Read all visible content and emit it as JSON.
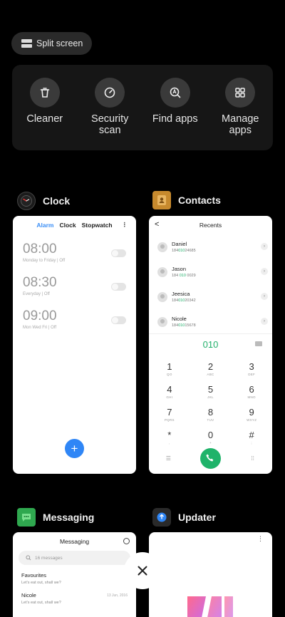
{
  "split_screen": {
    "label": "Split screen"
  },
  "quick_actions": [
    {
      "label": "Cleaner",
      "icon": "trash-icon"
    },
    {
      "label": "Security\nscan",
      "icon": "shield-scan-icon"
    },
    {
      "label": "Find apps",
      "icon": "search-apps-icon"
    },
    {
      "label": "Manage\napps",
      "icon": "grid-icon"
    }
  ],
  "clock": {
    "title": "Clock",
    "tabs": [
      "Alarm",
      "Clock",
      "Stopwatch"
    ],
    "more": "⋮",
    "alarms": [
      {
        "time": "08:00",
        "desc": "Monday to Friday | Off"
      },
      {
        "time": "08:30",
        "desc": "Everyday | Off"
      },
      {
        "time": "09:00",
        "desc": "Mon Wed Fri | Off"
      }
    ],
    "fab": "+"
  },
  "contacts": {
    "title": "Contacts",
    "header": "Recents",
    "back": "<",
    "recents": [
      {
        "name": "Daniel",
        "pre": "184",
        "mid": "010",
        "post": "24685"
      },
      {
        "name": "Jason",
        "pre": "184 ",
        "mid": "010",
        "post": " 0029"
      },
      {
        "name": "Jeesica",
        "pre": "184",
        "mid": "010",
        "post": "20342"
      },
      {
        "name": "Nicole",
        "pre": "184",
        "mid": "010",
        "post": "15678"
      }
    ],
    "input": "010",
    "keys": [
      {
        "n": "1",
        "l": "QO"
      },
      {
        "n": "2",
        "l": "ABC"
      },
      {
        "n": "3",
        "l": "DEF"
      },
      {
        "n": "4",
        "l": "GHI"
      },
      {
        "n": "5",
        "l": "JKL"
      },
      {
        "n": "6",
        "l": "MNO"
      },
      {
        "n": "7",
        "l": "PQRS"
      },
      {
        "n": "8",
        "l": "TUV"
      },
      {
        "n": "9",
        "l": "WXYZ"
      },
      {
        "n": "*",
        "l": ","
      },
      {
        "n": "0",
        "l": "+"
      },
      {
        "n": "#",
        "l": ";"
      }
    ]
  },
  "messaging": {
    "title": "Messaging",
    "header": "Messaging",
    "search_placeholder": "16 messages",
    "threads": [
      {
        "name": "Favourites",
        "preview": "Let's eat out, shall we?",
        "date": ""
      },
      {
        "name": "Nicole",
        "preview": "Let's eat out, shall we?",
        "date": "13 Jun, 2016"
      }
    ]
  },
  "updater": {
    "title": "Updater",
    "more": "⋮"
  },
  "colors": {
    "accent_blue": "#2f86f6",
    "call_green": "#1fb36a",
    "highlight_green": "#22b06b"
  }
}
